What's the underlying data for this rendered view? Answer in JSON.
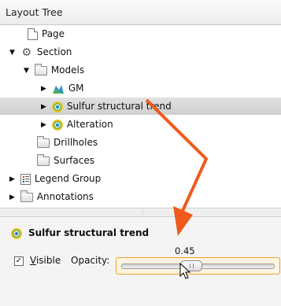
{
  "panel": {
    "title": "Layout Tree"
  },
  "tree": {
    "items": [
      {
        "label": "Page",
        "expander": "",
        "icon": "page-icon"
      },
      {
        "label": "Section",
        "expander": "▼",
        "icon": "section-icon"
      },
      {
        "label": "Models",
        "expander": "▼",
        "icon": "folder-icon"
      },
      {
        "label": "GM",
        "expander": "▶",
        "icon": "geological-model-icon"
      },
      {
        "label": "Sulfur structural trend",
        "expander": "▶",
        "icon": "interpolant-icon",
        "selected": true
      },
      {
        "label": "Alteration",
        "expander": "▶",
        "icon": "interpolant-icon"
      },
      {
        "label": "Drillholes",
        "expander": "",
        "icon": "folder-icon"
      },
      {
        "label": "Surfaces",
        "expander": "",
        "icon": "folder-icon"
      },
      {
        "label": "Legend Group",
        "expander": "▶",
        "icon": "legend-icon"
      },
      {
        "label": "Annotations",
        "expander": "▶",
        "icon": "folder-icon"
      }
    ]
  },
  "splitter": {
    "grip": "⋮"
  },
  "properties": {
    "title": "Sulfur structural trend",
    "visible_checked": true,
    "visible_mark": "✓",
    "visible_label_accel": "V",
    "visible_label_rest": "isible",
    "opacity_label": "Opacity:",
    "opacity_value": "0.45",
    "opacity": 0.45
  },
  "colors": {
    "annotation_arrow": "#f05a1a",
    "slider_focus": "#f0a030",
    "selection": "#d6d6d6"
  }
}
